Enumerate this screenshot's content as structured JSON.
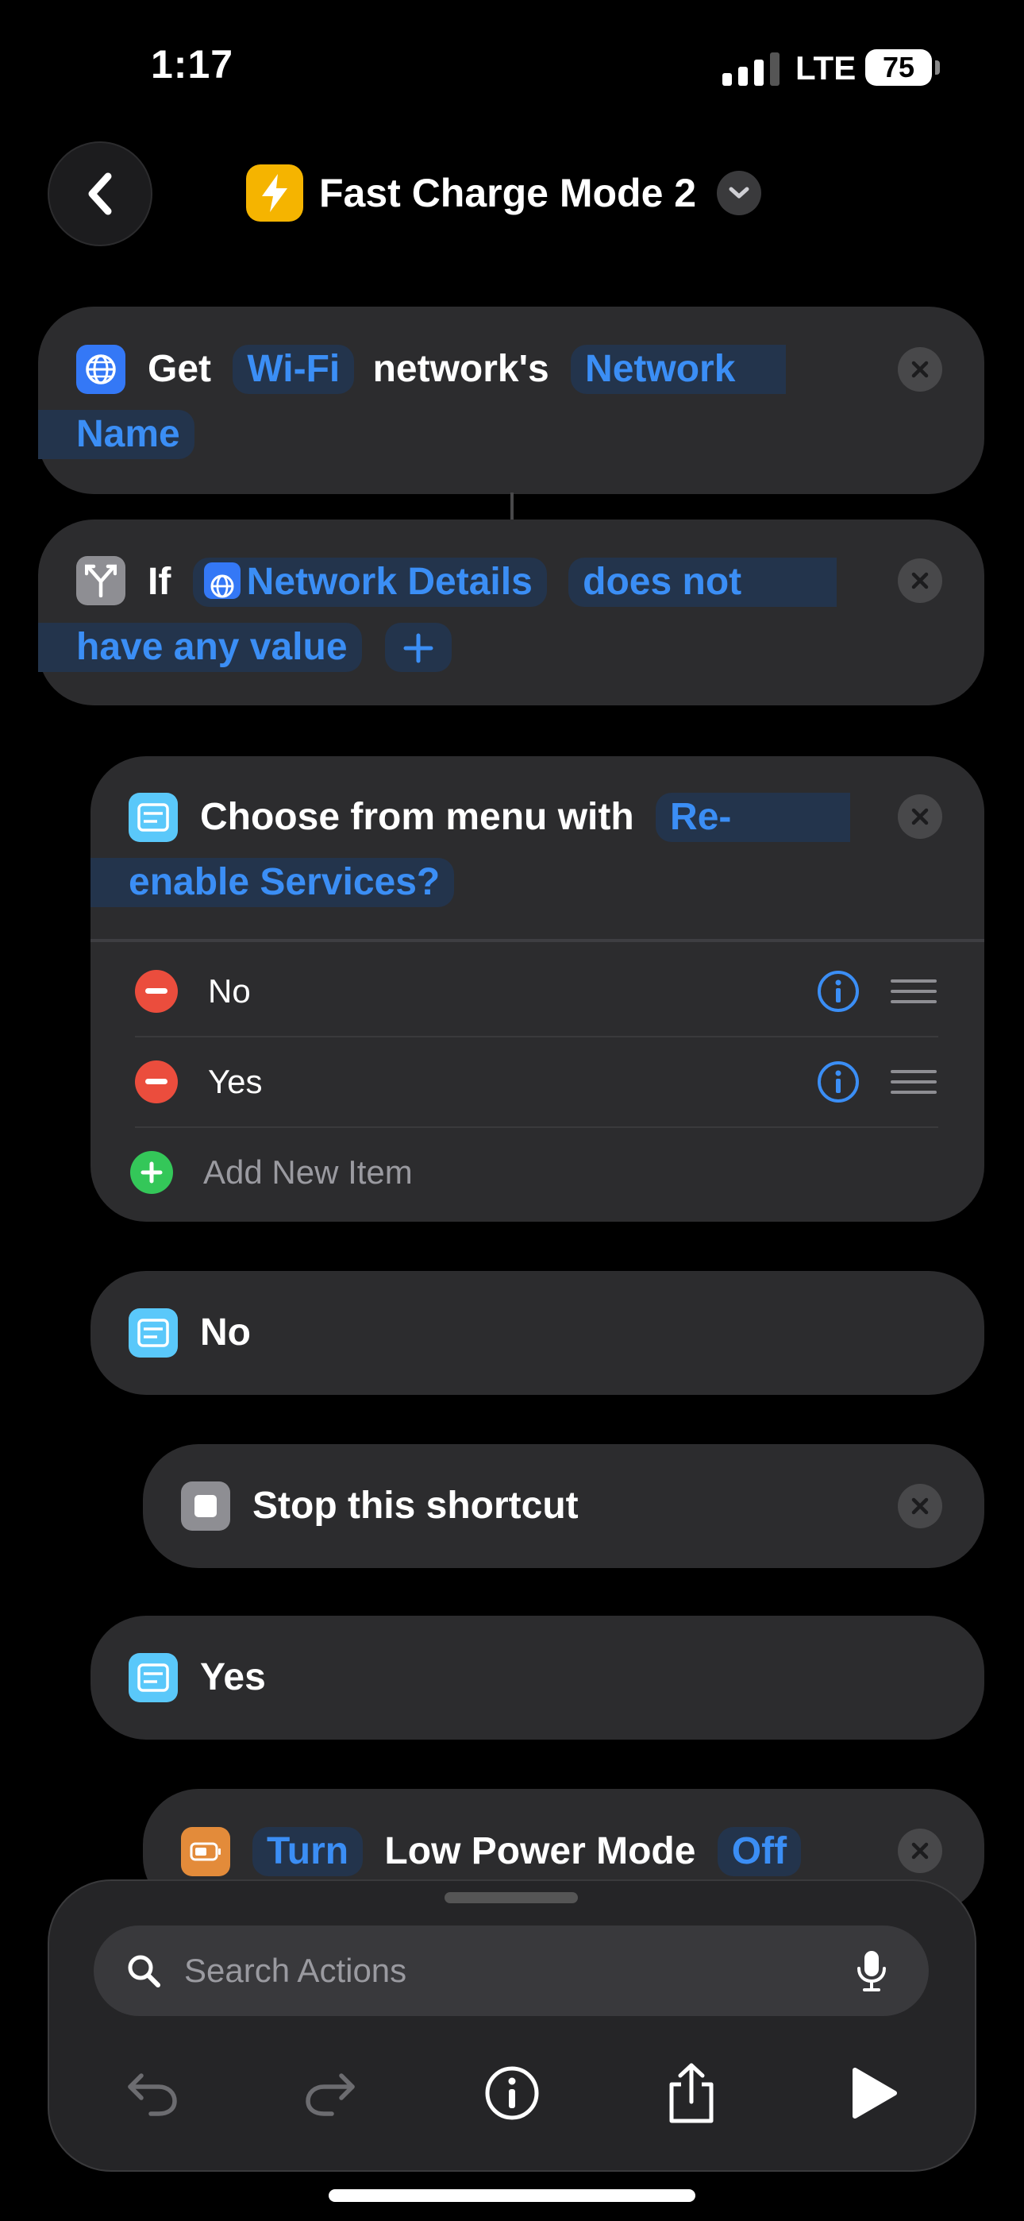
{
  "status_bar": {
    "time": "1:17",
    "network": "LTE",
    "battery": "75"
  },
  "header": {
    "title": "Fast Charge Mode 2"
  },
  "actions": {
    "get_wifi": {
      "get": "Get",
      "wifi": "Wi-Fi",
      "networks": "network's",
      "network_name_1": "Network",
      "network_name_2": "Name"
    },
    "if": {
      "if": "If",
      "variable": "Network Details",
      "condition_1": "does not",
      "condition_2": "have any value"
    },
    "choose_menu": {
      "text": "Choose from menu with",
      "prompt_1": "Re-",
      "prompt_2": "enable Services?",
      "items": [
        {
          "label": "No"
        },
        {
          "label": "Yes"
        }
      ],
      "add_item": "Add New Item"
    },
    "case_no": {
      "label": "No"
    },
    "stop": {
      "label": "Stop this shortcut"
    },
    "case_yes": {
      "label": "Yes"
    },
    "low_power": {
      "turn": "Turn",
      "label": "Low Power Mode",
      "state": "Off"
    }
  },
  "bottom_panel": {
    "search_placeholder": "Search Actions"
  },
  "colors": {
    "accent": "#3b8ef5",
    "card": "#2c2c2e",
    "background": "#000000",
    "app_icon": "#f5b400"
  }
}
